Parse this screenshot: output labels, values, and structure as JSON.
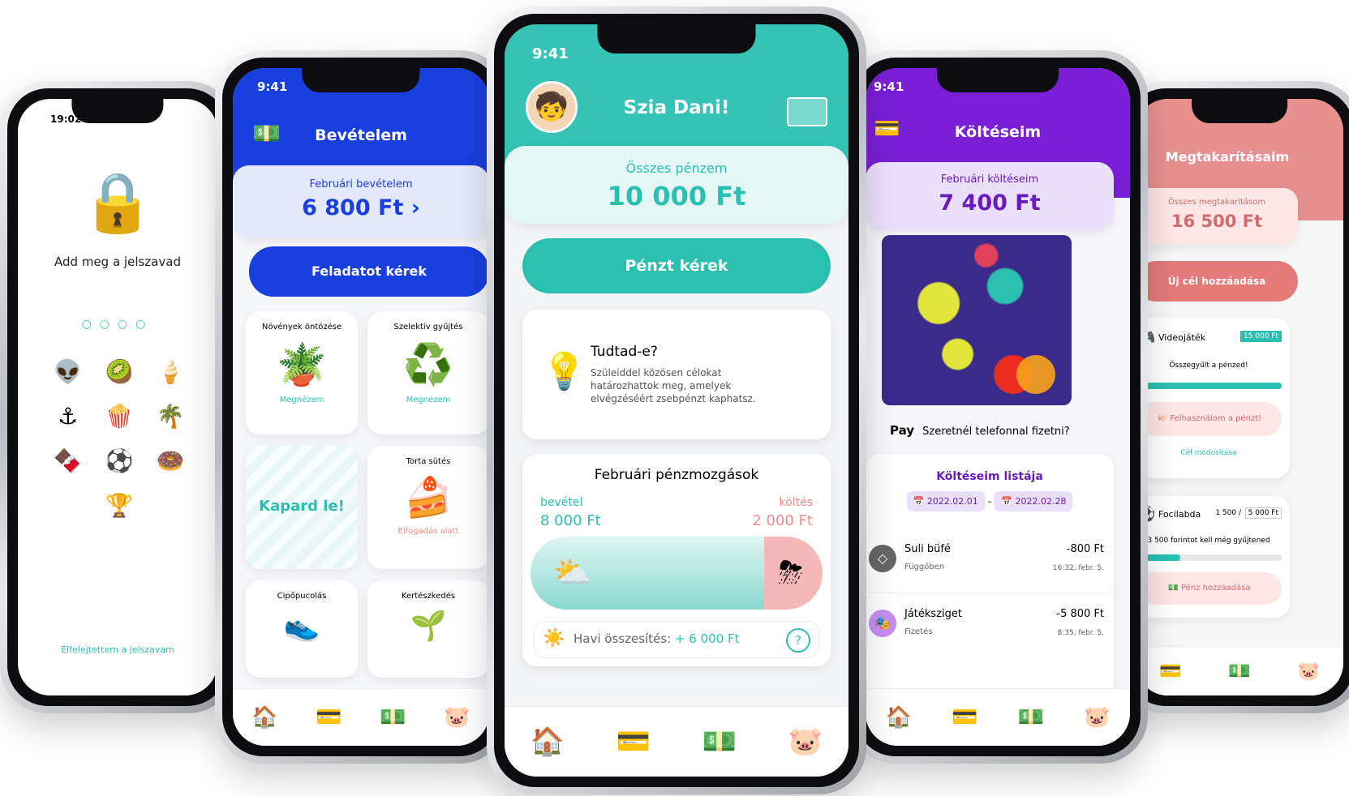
{
  "lock_screen": {
    "time": "19:02",
    "prompt": "Add meg a jelszavad",
    "emojis": [
      "👽",
      "🥝",
      "🍦",
      "⚓",
      "🍿",
      "🌴",
      "🍫",
      "⚽",
      "🍩",
      "🏆"
    ],
    "forgot": "Elfelejtettem a jelszavam"
  },
  "income": {
    "time": "9:41",
    "title": "Bevételem",
    "summary_label": "Februári bevételem",
    "summary_value": "6 800 Ft ›",
    "request_button": "Feladatot kérek",
    "tasks": [
      {
        "title": "Növények öntözése",
        "icon": "🪴",
        "action": "Megnézem"
      },
      {
        "title": "Szelektív gyűjtés",
        "icon": "♻️",
        "action": "Megnézem"
      },
      {
        "title": "Kapard le!",
        "icon": "",
        "action": ""
      },
      {
        "title": "Torta sütés",
        "icon": "🍰",
        "action": "Elfogadás alatt"
      },
      {
        "title": "Cipőpucolás",
        "icon": "👟",
        "action": ""
      },
      {
        "title": "Kertészkedés",
        "icon": "🌱",
        "action": ""
      }
    ],
    "accent": "#1a3fe0"
  },
  "home": {
    "time": "9:41",
    "greeting": "Szia Dani!",
    "total_label": "Összes pénzem",
    "total_value": "10 000 Ft",
    "request_button": "Pénzt kérek",
    "tip_title": "Tudtad-e?",
    "tip_text": "Szüleiddel közösen célokat határozhattok meg, amelyek elvégzéséért zsebpénzt kaphatsz.",
    "movements_title": "Februári pénzmozgások",
    "income_label": "bevétel",
    "income_value": "8 000 Ft",
    "expense_label": "költés",
    "expense_value": "2 000 Ft",
    "income_share": 0.8,
    "summary_label": "Havi összesítés:",
    "summary_value": "+ 6 000 Ft",
    "help": "?",
    "accent": "#2bbfb0"
  },
  "spending": {
    "time": "9:41",
    "title": "Költéseim",
    "summary_label": "Februári költéseim",
    "summary_value": "7 400 Ft",
    "apple_pay": "Pay",
    "apple_pay_text": "Szeretnél telefonnal fizetni?",
    "list_title": "Költéseim listája",
    "date_from": "2022.02.01",
    "date_to": "2022.02.28",
    "dash": "–",
    "items": [
      {
        "name": "Suli büfé",
        "status": "Függőben",
        "amount": "-800 Ft",
        "time": "16:32, febr. 5."
      },
      {
        "name": "Játéksziget",
        "status": "Fizetés",
        "amount": "-5 800 Ft",
        "time": "8:35, febr. 5."
      }
    ],
    "accent": "#7a1fd6"
  },
  "savings": {
    "time": "9:41",
    "title": "Megtakarításaim",
    "summary_label": "Összes megtakarításom",
    "summary_value": "16 500 Ft",
    "add_goal": "Új cél hozzáadása",
    "goals": [
      {
        "name": "Videojáték",
        "target": "15 000 Ft",
        "status": "Összegyűlt a pénzed!",
        "progress": 1.0,
        "action": "Felhasználom a pénzt!",
        "edit": "Cél módosítása"
      },
      {
        "name": "Focilabda",
        "saved": "1 500 /",
        "target": "5 000 Ft",
        "status": "3 500 forintot kell még gyűjtened",
        "progress": 0.3,
        "action": "Pénz hozzáadása"
      }
    ],
    "accent": "#e57a7a"
  }
}
